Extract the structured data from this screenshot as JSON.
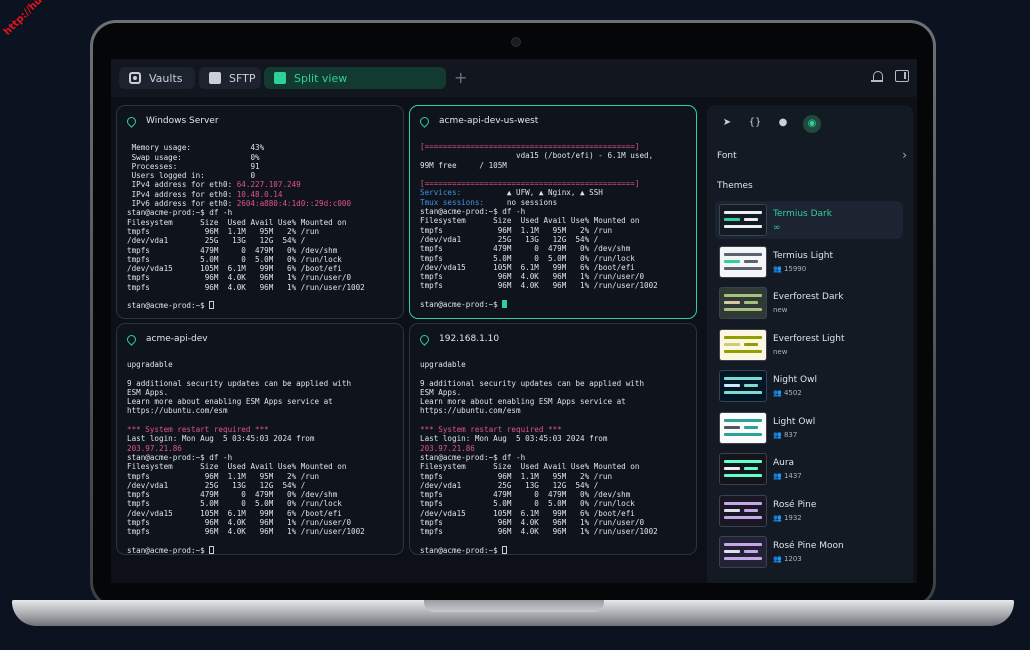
{
  "watermark": "http://hull.kr",
  "tabs": [
    {
      "label": "Vaults",
      "icon": "vault-icon"
    },
    {
      "label": "SFTP",
      "icon": "folder-icon"
    },
    {
      "label": "Split view",
      "icon": "split-view-icon",
      "active": true
    }
  ],
  "new_tab": "+",
  "terminals": [
    {
      "title": "Windows Server",
      "lines": [
        [
          {
            "t": ""
          }
        ],
        [
          {
            "t": " Memory usage:             43%"
          }
        ],
        [
          {
            "t": " Swap usage:               0%"
          }
        ],
        [
          {
            "t": " Processes:                91"
          }
        ],
        [
          {
            "t": " Users logged in:          0"
          }
        ],
        [
          {
            "t": " IPv4 address for eth0: "
          },
          {
            "t": "64.227.107.249",
            "c": "pink"
          }
        ],
        [
          {
            "t": " IPv4 address for eth0: "
          },
          {
            "t": "10.48.0.14",
            "c": "pink"
          }
        ],
        [
          {
            "t": " IPv6 address for eth0: "
          },
          {
            "t": "2604:a880:4:1d0::29d:c000",
            "c": "pink"
          }
        ],
        [
          {
            "t": "stan@acme-prod:~$ df -h"
          }
        ],
        [
          {
            "t": "Filesystem      Size  Used Avail Use% Mounted on"
          }
        ],
        [
          {
            "t": "tmpfs            96M  1.1M   95M   2% /run"
          }
        ],
        [
          {
            "t": "/dev/vda1        25G   13G   12G  54% /"
          }
        ],
        [
          {
            "t": "tmpfs           479M     0  479M   0% /dev/shm"
          }
        ],
        [
          {
            "t": "tmpfs           5.0M     0  5.0M   0% /run/lock"
          }
        ],
        [
          {
            "t": "/dev/vda15      105M  6.1M   99M   6% /boot/efi"
          }
        ],
        [
          {
            "t": "tmpfs            96M  4.0K   96M   1% /run/user/0"
          }
        ],
        [
          {
            "t": "tmpfs            96M  4.0K   96M   1% /run/user/1002"
          }
        ],
        [
          {
            "t": ""
          }
        ],
        [
          {
            "t": "stan@acme-prod:~$ "
          }
        ]
      ]
    },
    {
      "title": "acme-api-dev-us-west",
      "lines": [
        [
          {
            "t": "[==============================================]",
            "c": "pink"
          }
        ],
        [
          {
            "t": "                     vda15 (/boot/efi) - 6.1M used,"
          }
        ],
        [
          {
            "t": "99M free     / 105M"
          }
        ],
        [
          {
            "t": ""
          }
        ],
        [
          {
            "t": "[==============================================]",
            "c": "pink"
          }
        ],
        [
          {
            "t": "Services:",
            "c": "blue"
          },
          {
            "t": "          ▲ UFW, ▲ Nginx, ▲ SSH"
          }
        ],
        [
          {
            "t": "Tmux sessions:",
            "c": "blue"
          },
          {
            "t": "     no sessions"
          }
        ],
        [
          {
            "t": "stan@acme-prod:~$ df -h"
          }
        ],
        [
          {
            "t": "Filesystem      Size  Used Avail Use% Mounted on"
          }
        ],
        [
          {
            "t": "tmpfs            96M  1.1M   95M   2% /run"
          }
        ],
        [
          {
            "t": "/dev/vda1        25G   13G   12G  54% /"
          }
        ],
        [
          {
            "t": "tmpfs           479M     0  479M   0% /dev/shm"
          }
        ],
        [
          {
            "t": "tmpfs           5.0M     0  5.0M   0% /run/lock"
          }
        ],
        [
          {
            "t": "/dev/vda15      105M  6.1M   99M   6% /boot/efi"
          }
        ],
        [
          {
            "t": "tmpfs            96M  4.0K   96M   1% /run/user/0"
          }
        ],
        [
          {
            "t": "tmpfs            96M  4.0K   96M   1% /run/user/1002"
          }
        ],
        [
          {
            "t": ""
          }
        ],
        [
          {
            "t": "stan@acme-prod:~$ "
          }
        ]
      ]
    },
    {
      "title": "acme-api-dev",
      "lines": [
        [
          {
            "t": "upgradable"
          }
        ],
        [
          {
            "t": ""
          }
        ],
        [
          {
            "t": "9 additional security updates can be applied with"
          }
        ],
        [
          {
            "t": "ESM Apps."
          }
        ],
        [
          {
            "t": "Learn more about enabling ESM Apps service at"
          }
        ],
        [
          {
            "t": "https://ubuntu.com/esm"
          }
        ],
        [
          {
            "t": ""
          }
        ],
        [
          {
            "t": "*** System restart required ***",
            "c": "pink"
          }
        ],
        [
          {
            "t": "Last login: Mon Aug  5 03:45:03 2024 from"
          }
        ],
        [
          {
            "t": "203.97.21.86",
            "c": "pink"
          }
        ],
        [
          {
            "t": "stan@acme-prod:~$ df -h"
          }
        ],
        [
          {
            "t": "Filesystem      Size  Used Avail Use% Mounted on"
          }
        ],
        [
          {
            "t": "tmpfs            96M  1.1M   95M   2% /run"
          }
        ],
        [
          {
            "t": "/dev/vda1        25G   13G   12G  54% /"
          }
        ],
        [
          {
            "t": "tmpfs           479M     0  479M   0% /dev/shm"
          }
        ],
        [
          {
            "t": "tmpfs           5.0M     0  5.0M   0% /run/lock"
          }
        ],
        [
          {
            "t": "/dev/vda15      105M  6.1M   99M   6% /boot/efi"
          }
        ],
        [
          {
            "t": "tmpfs            96M  4.0K   96M   1% /run/user/0"
          }
        ],
        [
          {
            "t": "tmpfs            96M  4.0K   96M   1% /run/user/1002"
          }
        ],
        [
          {
            "t": ""
          }
        ],
        [
          {
            "t": "stan@acme-prod:~$ "
          }
        ]
      ]
    },
    {
      "title": "192.168.1.10",
      "lines": [
        [
          {
            "t": "upgradable"
          }
        ],
        [
          {
            "t": ""
          }
        ],
        [
          {
            "t": "9 additional security updates can be applied with"
          }
        ],
        [
          {
            "t": "ESM Apps."
          }
        ],
        [
          {
            "t": "Learn more about enabling ESM Apps service at"
          }
        ],
        [
          {
            "t": "https://ubuntu.com/esm"
          }
        ],
        [
          {
            "t": ""
          }
        ],
        [
          {
            "t": "*** System restart required ***",
            "c": "pink"
          }
        ],
        [
          {
            "t": "Last login: Mon Aug  5 03:45:03 2024 from"
          }
        ],
        [
          {
            "t": "203.97.21.86",
            "c": "pink"
          }
        ],
        [
          {
            "t": "stan@acme-prod:~$ df -h"
          }
        ],
        [
          {
            "t": "Filesystem      Size  Used Avail Use% Mounted on"
          }
        ],
        [
          {
            "t": "tmpfs            96M  1.1M   95M   2% /run"
          }
        ],
        [
          {
            "t": "/dev/vda1        25G   13G   12G  54% /"
          }
        ],
        [
          {
            "t": "tmpfs           479M     0  479M   0% /dev/shm"
          }
        ],
        [
          {
            "t": "tmpfs           5.0M     0  5.0M   0% /run/lock"
          }
        ],
        [
          {
            "t": "/dev/vda15      105M  6.1M   99M   6% /boot/efi"
          }
        ],
        [
          {
            "t": "tmpfs            96M  4.0K   96M   1% /run/user/0"
          }
        ],
        [
          {
            "t": "tmpfs            96M  4.0K   96M   1% /run/user/1002"
          }
        ],
        [
          {
            "t": ""
          }
        ],
        [
          {
            "t": "stan@acme-prod:~$ "
          }
        ]
      ]
    }
  ],
  "side_panel": {
    "icons": [
      "send-icon",
      "code-braces-icon",
      "history-icon",
      "palette-icon"
    ],
    "font_label": "Font",
    "themes_label": "Themes",
    "themes": [
      {
        "name": "Termius Dark",
        "sub": "∞",
        "selected": true,
        "bg": "#141a24",
        "bar": "#2fd19a",
        "bar2": "#e9ecf1"
      },
      {
        "name": "Termius Light",
        "sub": "15990",
        "bg": "#f4f5f7",
        "bar": "#2fd19a",
        "bar2": "#5a6272"
      },
      {
        "name": "Everforest Dark",
        "sub": "new",
        "bg": "#2f3a36",
        "bar": "#d9c9a3",
        "bar2": "#a7c080"
      },
      {
        "name": "Everforest Light",
        "sub": "new",
        "bg": "#fdf6e3",
        "bar": "#c5d07a",
        "bar2": "#8da101"
      },
      {
        "name": "Night Owl",
        "sub": "4502",
        "bg": "#011627",
        "bar": "#c9e8ff",
        "bar2": "#7fdbca"
      },
      {
        "name": "Light Owl",
        "sub": "837",
        "bg": "#fbfbfb",
        "bar": "#4d5866",
        "bar2": "#2aa298"
      },
      {
        "name": "Aura",
        "sub": "1437",
        "bg": "#15141b",
        "bar": "#edecee",
        "bar2": "#61ffca"
      },
      {
        "name": "Rosé Pine",
        "sub": "1932",
        "bg": "#191724",
        "bar": "#e0def4",
        "bar2": "#c4a7e7"
      },
      {
        "name": "Rosé Pine Moon",
        "sub": "1203",
        "bg": "#232136",
        "bar": "#e0def4",
        "bar2": "#c4a7e7"
      }
    ]
  }
}
